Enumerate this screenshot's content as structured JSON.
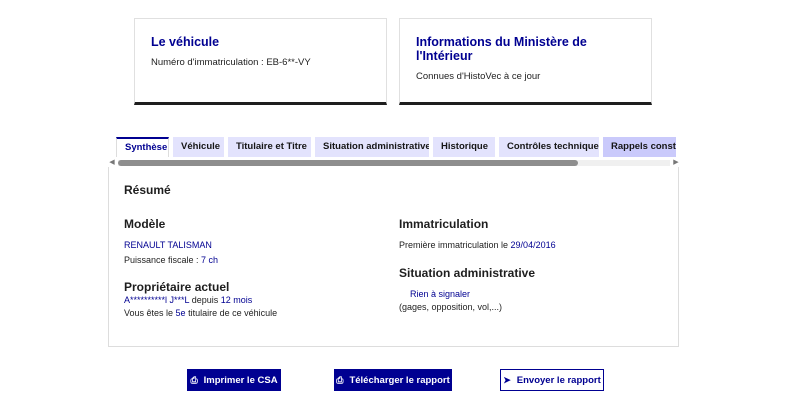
{
  "cards": [
    {
      "title": "Le véhicule",
      "desc": "Numéro d'immatriculation : EB-6**-VY"
    },
    {
      "title": "Informations du Ministère de l'Intérieur",
      "desc": "Connues d'HistoVec à ce jour"
    }
  ],
  "tabs": [
    {
      "label": "Synthèse"
    },
    {
      "label": "Véhicule"
    },
    {
      "label": "Titulaire et Titre"
    },
    {
      "label": "Situation administrative"
    },
    {
      "label": "Historique"
    },
    {
      "label": "Contrôles techniques"
    },
    {
      "label": "Rappels constructeur"
    }
  ],
  "summary": {
    "title": "Résumé",
    "model": {
      "heading": "Modèle",
      "name": "RENAULT TALISMAN",
      "power_label": "Puissance fiscale : ",
      "power_value": "7 ch"
    },
    "owner": {
      "heading": "Propriétaire actuel",
      "name": "A**********l J***L",
      "since_label": " depuis ",
      "since_value": "12 mois",
      "count_prefix": "Vous êtes le ",
      "count_value": "5e",
      "count_suffix": " titulaire de ce véhicule"
    },
    "registration": {
      "heading": "Immatriculation",
      "first_label": "Première immatriculation le ",
      "first_date": "29/04/2016"
    },
    "admin": {
      "heading": "Situation administrative",
      "status": "Rien à signaler",
      "note": "(gages, opposition, vol,...)"
    }
  },
  "actions": {
    "print_csa": "Imprimer le CSA",
    "download_report": "Télécharger le rapport",
    "send_report": "Envoyer le rapport"
  }
}
